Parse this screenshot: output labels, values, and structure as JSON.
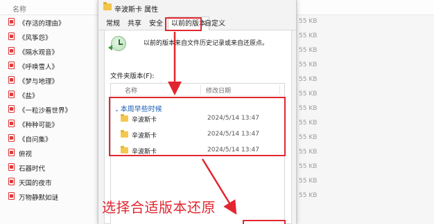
{
  "explorer": {
    "column_name": "名称",
    "files": [
      "《存活的理由》",
      "《风筝怨》",
      "《隔水观音》",
      "《呼唤雪人》",
      "《梦与地理》",
      "《盐》",
      "《一粒沙看世界》",
      "《种种可能》",
      "《自问集》",
      "俯视",
      "石器时代",
      "天国的夜市",
      "万物静默如谜"
    ],
    "sizes": [
      "55 KB",
      "55 KB",
      "55 KB",
      "55 KB",
      "55 KB",
      "55 KB",
      "55 KB",
      "55 KB",
      "55 KB",
      "55 KB",
      "55 KB",
      "55 KB",
      "55 KB"
    ]
  },
  "dialog": {
    "title": "辛波斯卡 属性",
    "tabs": [
      "常规",
      "共享",
      "安全",
      "以前的版本",
      "自定义"
    ],
    "active_tab": "以前的版本",
    "description": "以前的版本来自文件历史记录或来自还原点。",
    "versions_label": "文件夹版本(F):",
    "columns": {
      "name": "名称",
      "modified": "修改日期"
    },
    "group_title": "本周早些时候",
    "versions": [
      {
        "name": "辛波斯卡",
        "date": "2024/5/14 13:47"
      },
      {
        "name": "辛波斯卡",
        "date": "2024/5/14 13:47"
      },
      {
        "name": "辛波斯卡",
        "date": "2024/5/14 13:47"
      }
    ]
  },
  "annotation": {
    "caption": "选择合适版本还原",
    "color": "#e2262f"
  },
  "icons": {
    "title": "folder-icon",
    "history": "clock-restore-icon",
    "version_item": "folder-icon",
    "file_item": "pdf-file-icon"
  }
}
